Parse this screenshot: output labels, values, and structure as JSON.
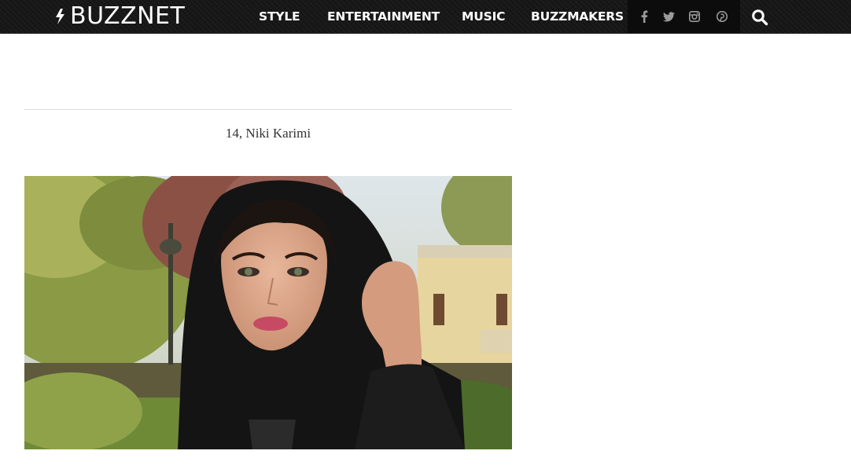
{
  "header": {
    "logo_text": "BUZZNET",
    "nav": [
      {
        "label": "STYLE"
      },
      {
        "label": "ENTERTAINMENT"
      },
      {
        "label": "MUSIC"
      },
      {
        "label": "BUZZMAKERS"
      }
    ],
    "social_icons": [
      "facebook-icon",
      "twitter-icon",
      "instagram-icon",
      "pinterest-icon"
    ],
    "search_icon": "search-icon"
  },
  "article": {
    "caption": "14, Niki Karimi"
  },
  "colors": {
    "topbar": "#151515",
    "social_bg": "#0c0c0c",
    "caption_text": "#333333",
    "divider": "#dcdcdc"
  }
}
